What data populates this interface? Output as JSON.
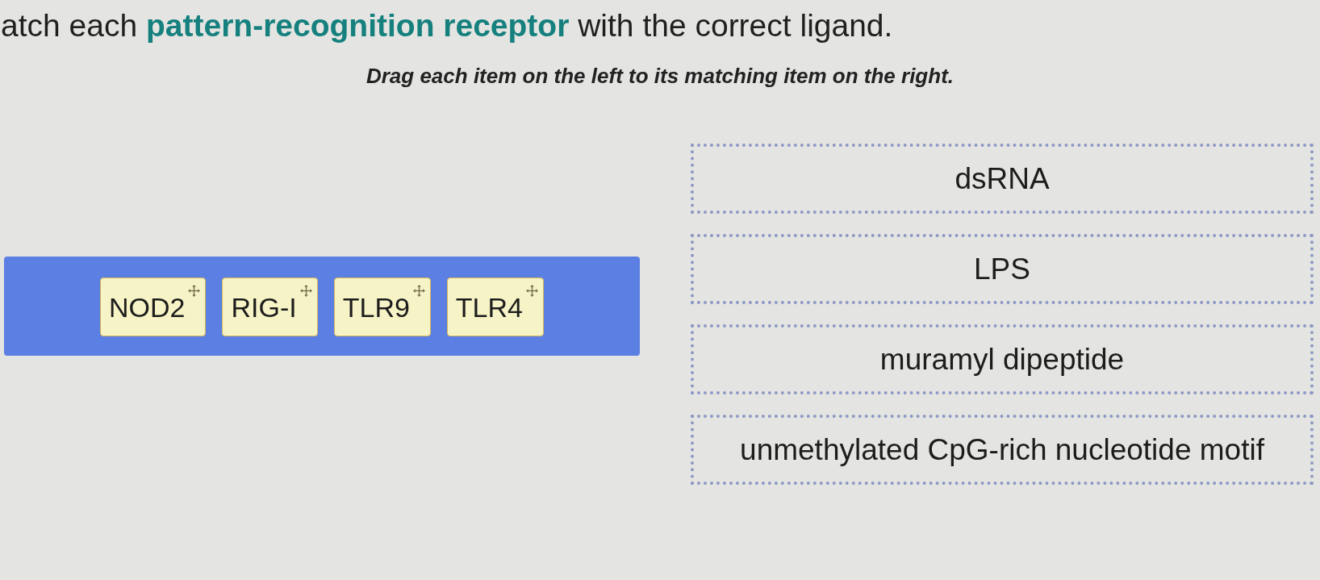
{
  "question": {
    "title": "atch each **pattern-recognition receptor** with the correct ligand.",
    "instruction": "Drag each item on the left to its matching item on the right."
  },
  "item_bank": {
    "items": [
      {
        "label": "NOD2"
      },
      {
        "label": "RIG-I"
      },
      {
        "label": "TLR9"
      },
      {
        "label": "TLR4"
      }
    ]
  },
  "targets": [
    {
      "label": "dsRNA"
    },
    {
      "label": "LPS"
    },
    {
      "label": "muramyl dipeptide"
    },
    {
      "label": "unmethylated CpG-rich nucleotide motif"
    }
  ]
}
